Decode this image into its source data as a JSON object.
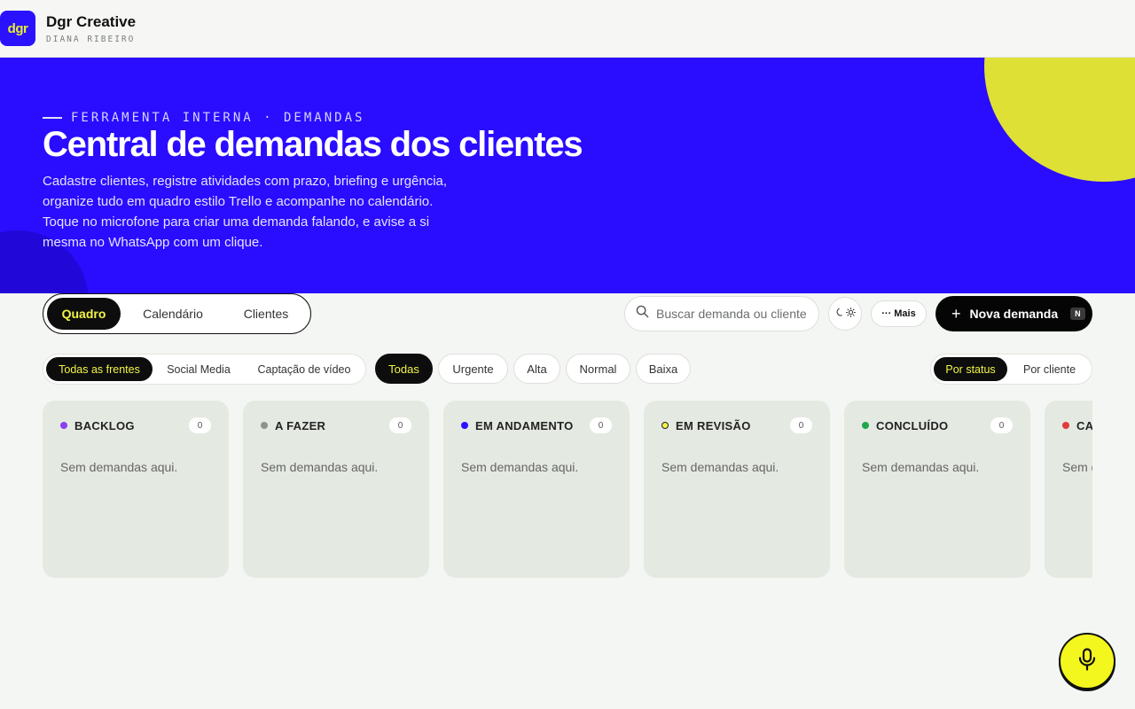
{
  "app": {
    "logo_text": "dgr",
    "name": "Dgr Creative",
    "user": "DIANA RIBEIRO"
  },
  "hero": {
    "eyebrow": "FERRAMENTA INTERNA · DEMANDAS",
    "title": "Central de demandas dos clientes",
    "description": "Cadastre clientes, registre atividades com prazo, briefing e urgência, organize tudo em quadro estilo Trello e acompanhe no calendário. Toque no microfone para criar uma demanda falando, e avise a si mesma no WhatsApp com um clique."
  },
  "views": [
    {
      "label": "Quadro",
      "active": true
    },
    {
      "label": "Calendário",
      "active": false
    },
    {
      "label": "Clientes",
      "active": false
    }
  ],
  "search": {
    "placeholder": "Buscar demanda ou cliente",
    "value": ""
  },
  "toolbar": {
    "more_label": "Mais",
    "new_label": "Nova demanda",
    "new_shortcut": "N"
  },
  "fronts": [
    {
      "label": "Todas as frentes",
      "active": true
    },
    {
      "label": "Social Media",
      "active": false
    },
    {
      "label": "Captação de vídeo",
      "active": false
    }
  ],
  "priorities": [
    {
      "label": "Todas",
      "active": true
    },
    {
      "label": "Urgente",
      "active": false
    },
    {
      "label": "Alta",
      "active": false
    },
    {
      "label": "Normal",
      "active": false
    },
    {
      "label": "Baixa",
      "active": false
    }
  ],
  "grouping": [
    {
      "label": "Por status",
      "active": true
    },
    {
      "label": "Por cliente",
      "active": false
    }
  ],
  "columns": [
    {
      "title": "BACKLOG",
      "count": "0",
      "empty": "Sem demandas aqui.",
      "color": "#8a3ff0"
    },
    {
      "title": "A FAZER",
      "count": "0",
      "empty": "Sem demandas aqui.",
      "color": "#8e948d"
    },
    {
      "title": "EM ANDAMENTO",
      "count": "0",
      "empty": "Sem demandas aqui.",
      "color": "#2a12ff"
    },
    {
      "title": "EM REVISÃO",
      "count": "0",
      "empty": "Sem demandas aqui.",
      "color": "#f2f545"
    },
    {
      "title": "CONCLUÍDO",
      "count": "0",
      "empty": "Sem demandas aqui.",
      "color": "#1fa64a"
    },
    {
      "title": "CA",
      "count": "",
      "empty": "Sem d",
      "color": "#e23b3b"
    }
  ],
  "colors": {
    "brand": "#2a0cff",
    "accent": "#f2f545",
    "yellow_blob": "#dfe035"
  }
}
